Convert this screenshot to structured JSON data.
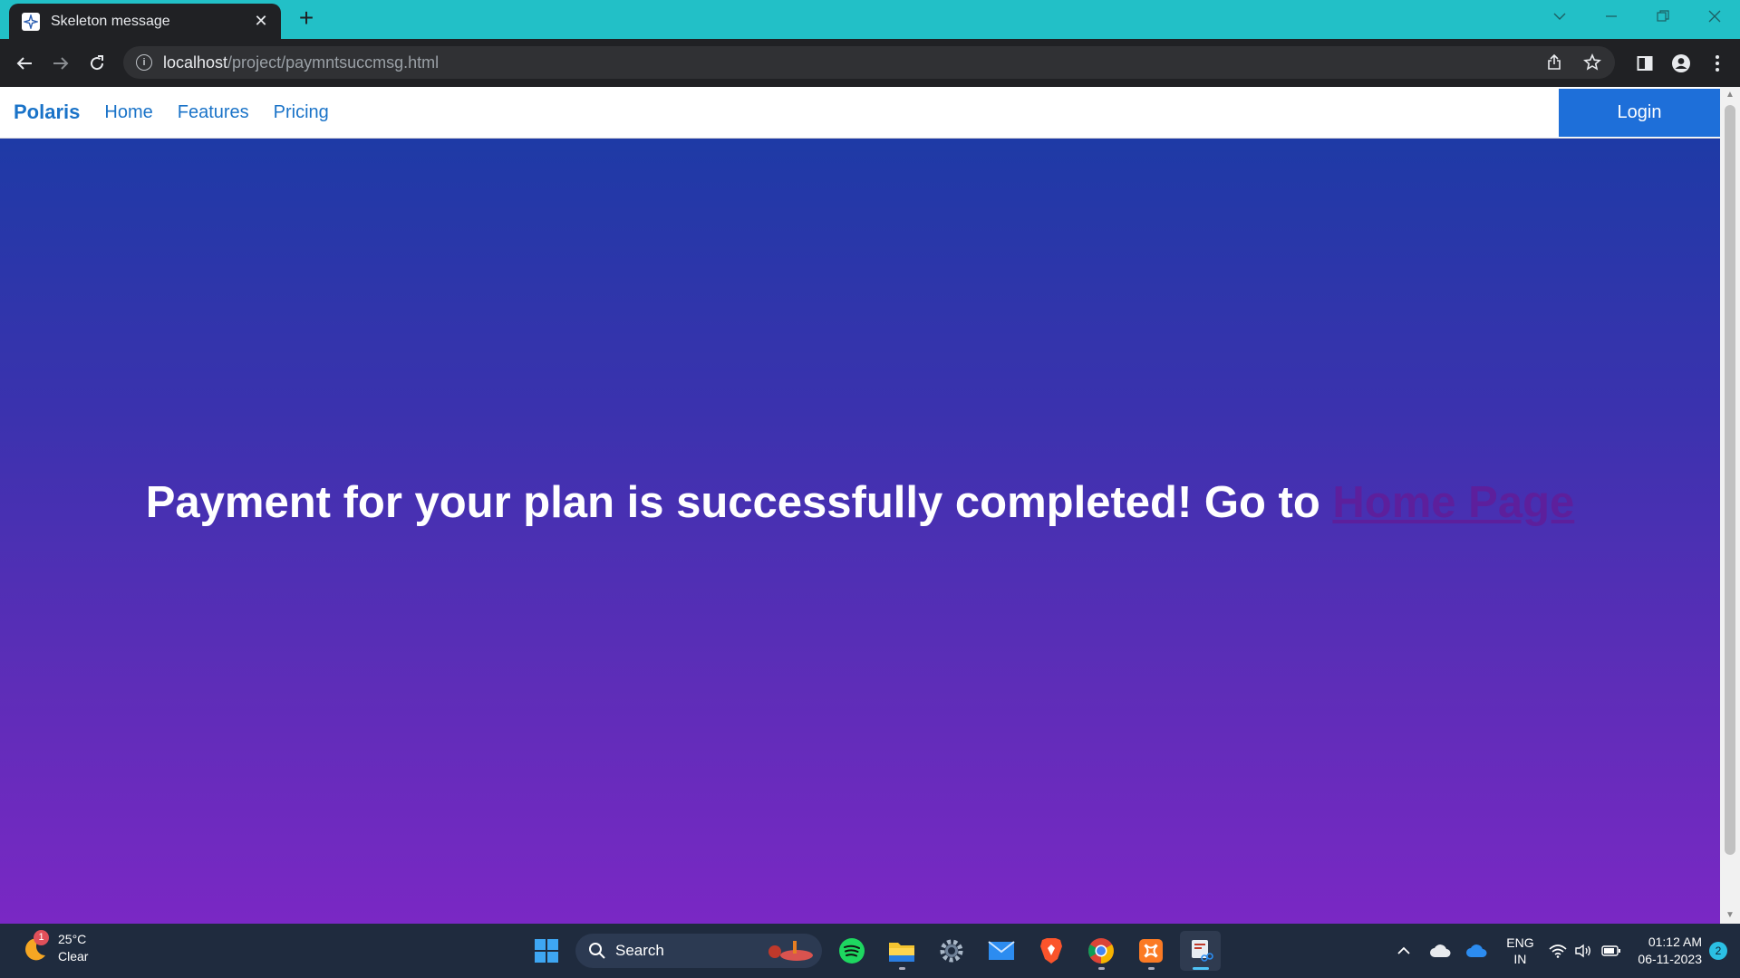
{
  "browser": {
    "tab_title": "Skeleton message",
    "url_host": "localhost",
    "url_path": "/project/paymntsuccmsg.html"
  },
  "navbar": {
    "brand": "Polaris",
    "links": [
      "Home",
      "Features",
      "Pricing"
    ],
    "login_label": "Login"
  },
  "hero": {
    "message": "Payment for your plan is successfully completed! Go to ",
    "link_text": "Home Page"
  },
  "taskbar": {
    "weather_badge": "1",
    "temperature": "25°C",
    "condition": "Clear",
    "search_label": "Search",
    "lang_top": "ENG",
    "lang_bottom": "IN",
    "time": "01:12 AM",
    "date": "06-11-2023",
    "notification_count": "2"
  },
  "colors": {
    "tabstrip": "#22c0c7",
    "brand_blue": "#1a73c8",
    "login_button": "#1e6fd9",
    "hero_gradient_top": "#1e3aa6",
    "hero_gradient_bottom": "#7a28c4",
    "link_visited": "#5d1f9c"
  }
}
